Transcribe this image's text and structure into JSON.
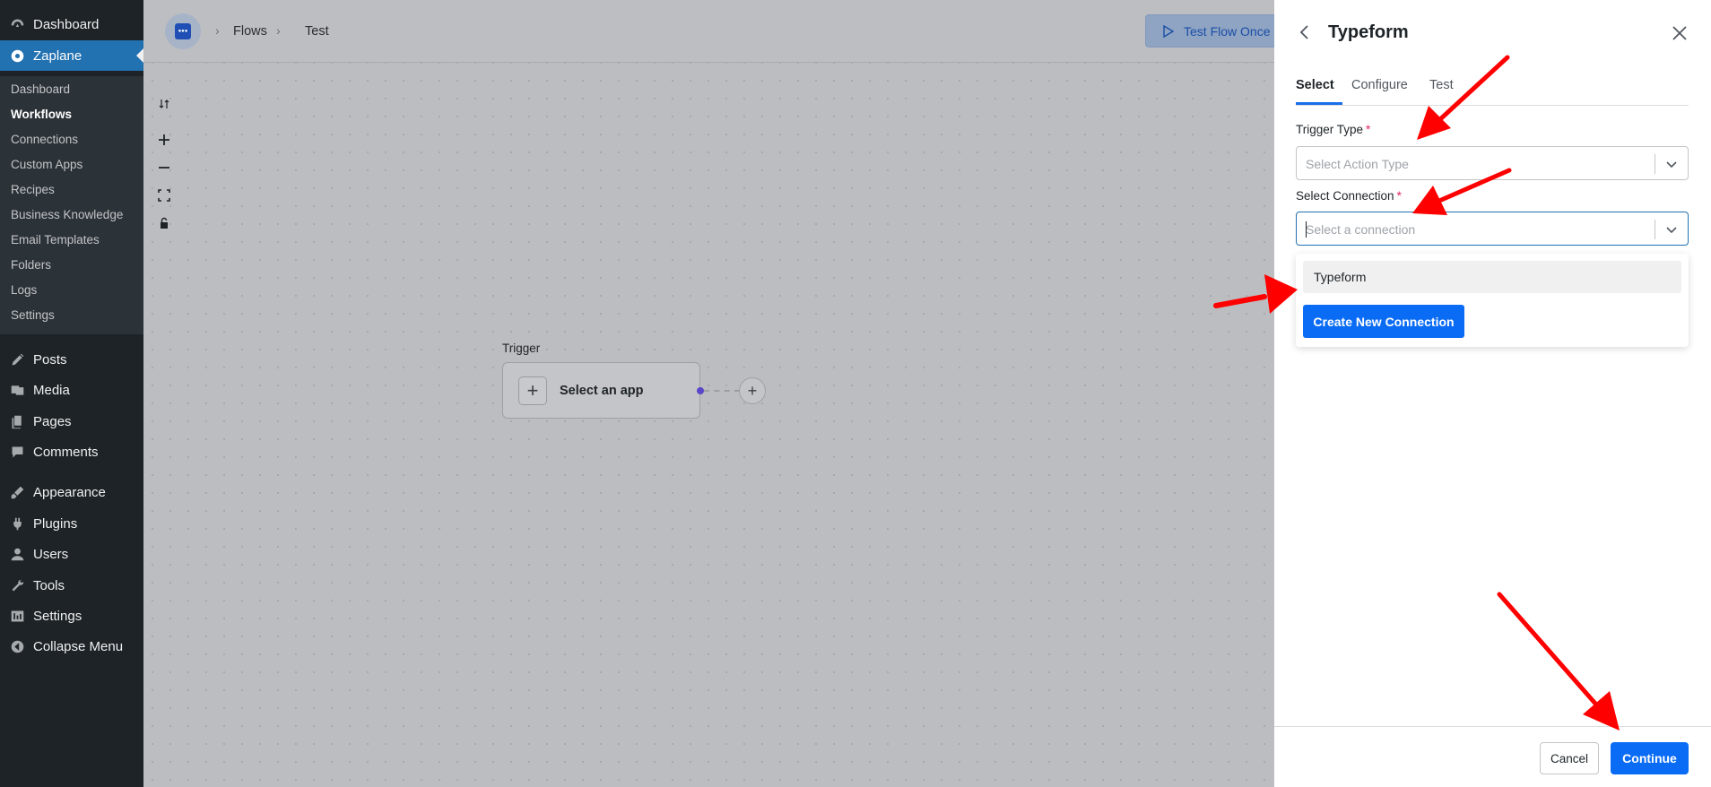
{
  "wp_menu": {
    "dashboard": "Dashboard",
    "zaplane": "Zaplane",
    "submenu": [
      "Dashboard",
      "Workflows",
      "Connections",
      "Custom Apps",
      "Recipes",
      "Business Knowledge",
      "Email Templates",
      "Folders",
      "Logs",
      "Settings"
    ],
    "submenu_active": "Workflows",
    "posts": "Posts",
    "media": "Media",
    "pages": "Pages",
    "comments": "Comments",
    "appearance": "Appearance",
    "plugins": "Plugins",
    "users": "Users",
    "tools": "Tools",
    "settings": "Settings",
    "collapse": "Collapse Menu"
  },
  "topbar": {
    "breadcrumb": [
      "Flows",
      "Test"
    ],
    "test_flow_label": "Test Flow Once"
  },
  "canvas": {
    "trigger_label": "Trigger",
    "trigger_card_text": "Select an app"
  },
  "drawer": {
    "title": "Typeform",
    "tabs": [
      "Select",
      "Configure",
      "Test"
    ],
    "active_tab": "Select",
    "trigger_type_label": "Trigger Type",
    "trigger_type_placeholder": "Select Action Type",
    "connection_label": "Select Connection",
    "connection_placeholder": "Select a connection",
    "dropdown_option": "Typeform",
    "create_connection_label": "Create New Connection",
    "required_mark": "*",
    "cancel_label": "Cancel",
    "continue_label": "Continue"
  },
  "colors": {
    "wp_sidebar": "#1d2327",
    "wp_accent": "#2271b1",
    "primary_button": "#0a6cf5",
    "annotation_arrow": "#ff0000"
  },
  "icons": [
    "dashboard-icon",
    "zaplane-icon",
    "posts-icon",
    "media-icon",
    "pages-icon",
    "comments-icon",
    "appearance-icon",
    "plugins-icon",
    "users-icon",
    "tools-icon",
    "settings-icon",
    "collapse-icon",
    "play-icon",
    "back-icon",
    "close-icon",
    "chevron-down-icon"
  ]
}
